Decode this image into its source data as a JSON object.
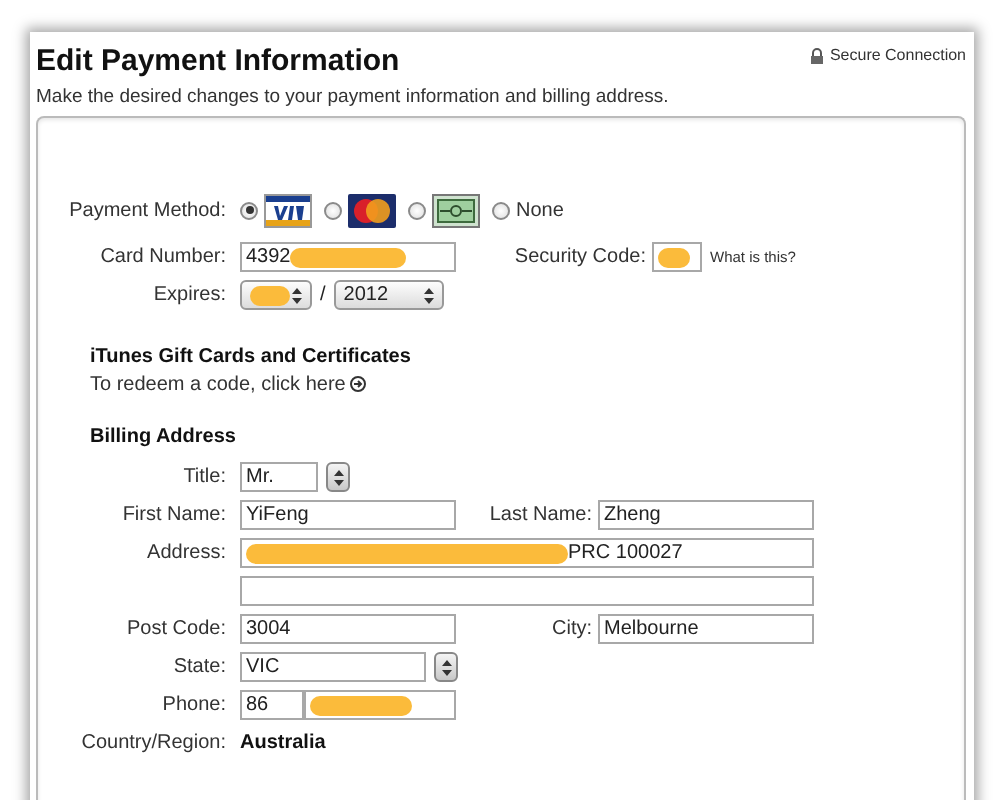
{
  "header": {
    "title": "Edit Payment Information",
    "secure": "Secure Connection"
  },
  "instructions": "Make the desired changes to your payment information and billing address.",
  "payment": {
    "label": "Payment Method:",
    "options": [
      {
        "kind": "visa",
        "selected": true
      },
      {
        "kind": "mastercard",
        "selected": false
      },
      {
        "kind": "card",
        "selected": false
      },
      {
        "kind": "text",
        "label": "None",
        "selected": false
      }
    ]
  },
  "card_number": {
    "label": "Card Number:",
    "value": "4392",
    "redacted": true
  },
  "security_code": {
    "label": "Security Code:",
    "redacted": true,
    "help": "What is this?"
  },
  "expires": {
    "label": "Expires:",
    "month_redacted": true,
    "separator": "/",
    "year": "2012"
  },
  "gift": {
    "heading": "iTunes Gift Cards and Certificates",
    "text": "To redeem a code, click here"
  },
  "billing": {
    "heading": "Billing Address",
    "rows": [
      {
        "fields": [
          {
            "kind": "select",
            "label": "Title:",
            "value": "Mr."
          }
        ]
      },
      {
        "fields": [
          {
            "kind": "text",
            "label": "First Name:",
            "value": "YiFeng"
          },
          {
            "kind": "text",
            "label": "Last Name:",
            "value": "Zheng"
          }
        ]
      },
      {
        "fields": [
          {
            "kind": "wide",
            "label": "Address:",
            "value": "PRC 100027",
            "redacted": true
          }
        ]
      },
      {
        "fields": [
          {
            "kind": "wide"
          }
        ]
      },
      {
        "fields": [
          {
            "kind": "text",
            "label": "Post Code:",
            "value": "3004"
          },
          {
            "kind": "text",
            "label": "City:",
            "value": "Melbourne"
          }
        ]
      },
      {
        "fields": [
          {
            "kind": "select",
            "label": "State:",
            "value": "VIC"
          }
        ]
      },
      {
        "fields": [
          {
            "kind": "phone",
            "label": "Phone:",
            "value": "86",
            "redacted": true
          }
        ]
      },
      {
        "fields": [
          {
            "kind": "static",
            "label": "Country/Region:",
            "value": "Australia"
          }
        ]
      }
    ]
  }
}
